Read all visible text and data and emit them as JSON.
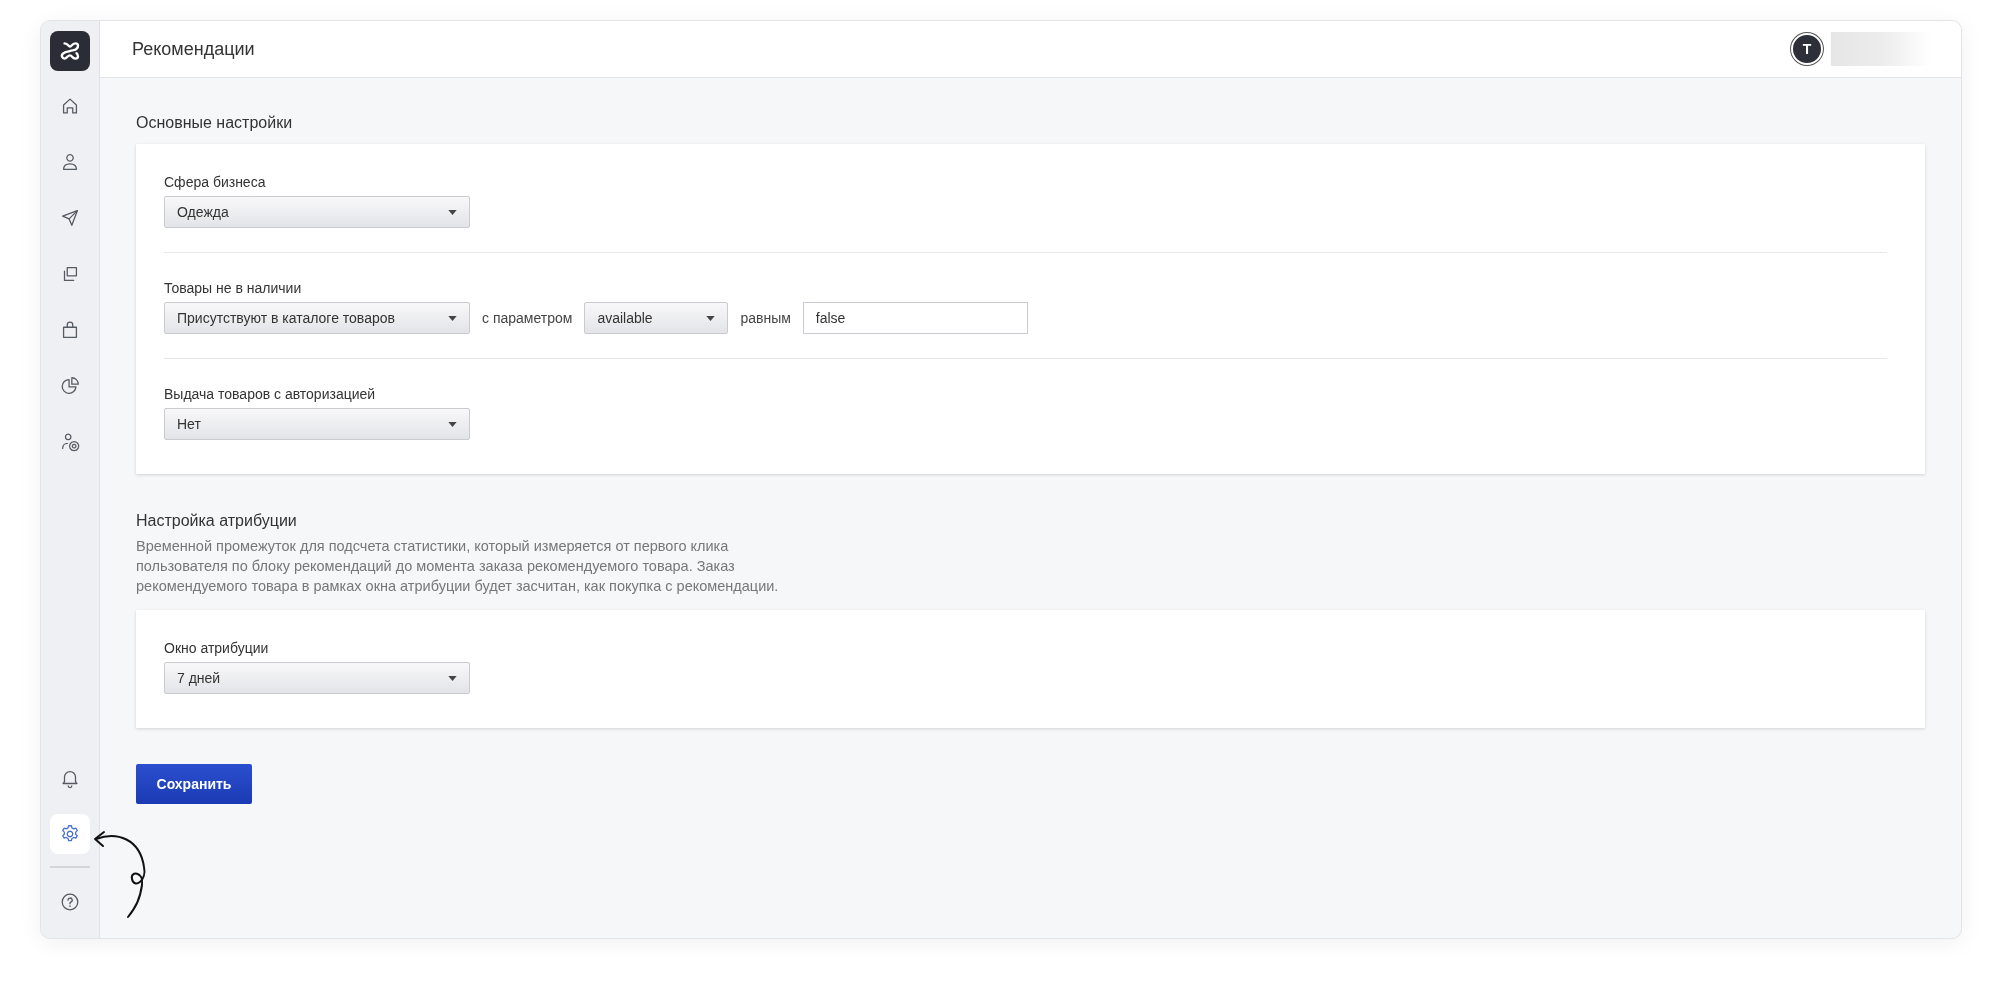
{
  "header": {
    "title": "Рекомендации",
    "avatar_letter": "T"
  },
  "sidebar": {
    "top_items": [
      {
        "selected": false
      },
      {
        "selected": false
      },
      {
        "selected": false
      },
      {
        "selected": false
      },
      {
        "selected": false
      },
      {
        "selected": false
      },
      {
        "selected": false
      }
    ],
    "bottom_items": [
      {
        "selected": false
      },
      {
        "selected": true
      }
    ],
    "help_item": {
      "selected": false
    }
  },
  "sections": [
    {
      "title": "Основные настройки",
      "groups": [
        {
          "label": "Сфера бизнеса",
          "controls": [
            {
              "kind": "select",
              "value": "Одежда"
            }
          ]
        },
        {
          "label": "Товары не в наличии",
          "controls": [
            {
              "kind": "select",
              "value": "Присутствуют в каталоге товаров"
            },
            {
              "kind": "text",
              "value": "с параметром"
            },
            {
              "kind": "compact_select",
              "value": "available"
            },
            {
              "kind": "text",
              "value": "равным"
            },
            {
              "kind": "input",
              "value": "false"
            }
          ]
        },
        {
          "label": "Выдача товаров с авторизацией",
          "controls": [
            {
              "kind": "select",
              "value": "Нет"
            }
          ]
        }
      ]
    },
    {
      "title": "Настройка атрибуции",
      "description": "Временной промежуток для подсчета статистики, который измеряется от первого клика пользователя по блоку рекомендаций до момента заказа рекомендуемого товара. Заказ рекомендуемого товара в рамках окна атрибуции будет засчитан, как покупка с рекомендации.",
      "groups": [
        {
          "label": "Окно атрибуции",
          "controls": [
            {
              "kind": "select",
              "value": "7 дней"
            }
          ]
        }
      ]
    }
  ],
  "save_button": {
    "label": "Сохранить"
  }
}
